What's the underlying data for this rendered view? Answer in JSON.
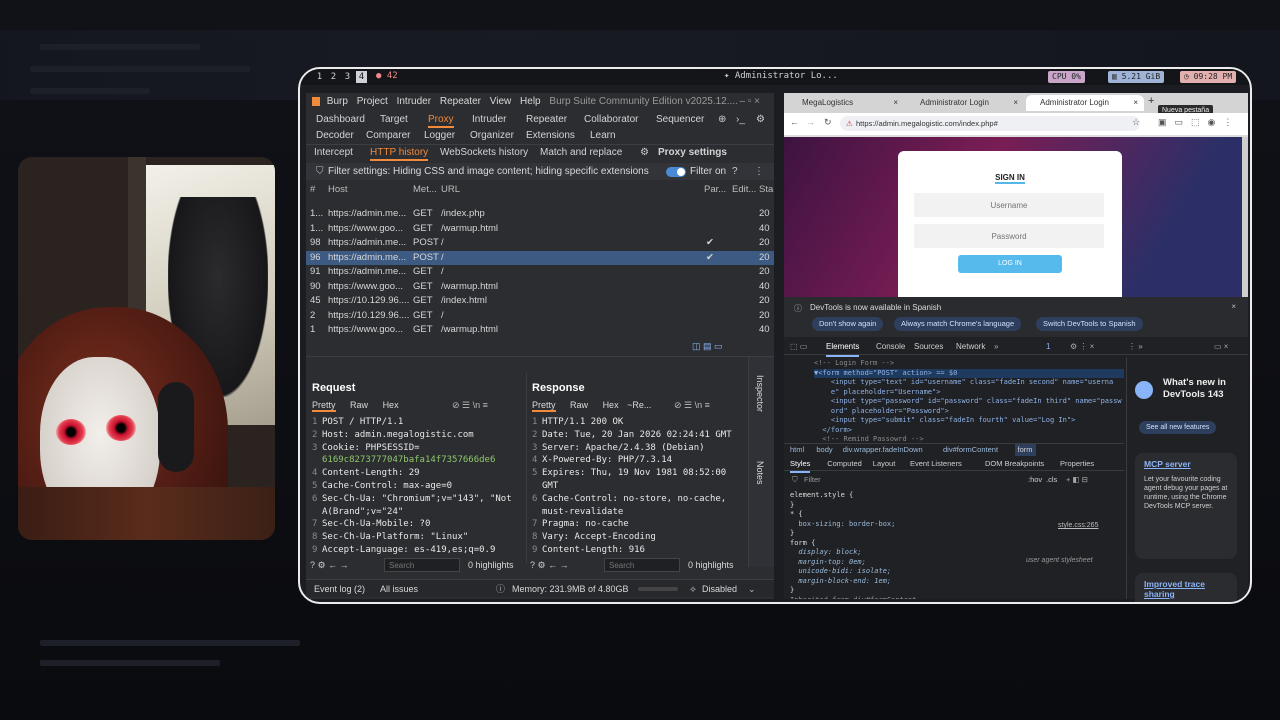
{
  "topbar": {
    "workspaces": [
      "1",
      "2",
      "3",
      "4"
    ],
    "badge": "● 42",
    "window_title": "✦ Administrator Lo...",
    "cpu": "CPU 0%",
    "mem": "▥ 5.21 GiB",
    "clock": "◷ 09:28 PM"
  },
  "burp": {
    "menu": [
      "Burp",
      "Project",
      "Intruder",
      "Repeater",
      "View",
      "Help"
    ],
    "title": "Burp Suite Community Edition v2025.12....",
    "tabs1": [
      "Dashboard",
      "Target",
      "Proxy",
      "Intruder",
      "Repeater",
      "Collaborator",
      "Sequencer"
    ],
    "tabs2": [
      "Decoder",
      "Comparer",
      "Logger",
      "Organizer",
      "Extensions",
      "Learn"
    ],
    "subtabs": [
      "Intercept",
      "HTTP history",
      "WebSockets history",
      "Match and replace"
    ],
    "proxy_settings": "Proxy settings",
    "filter_text": "Filter settings: Hiding CSS and image content; hiding specific extensions",
    "filter_on": "Filter on",
    "columns": [
      "#",
      "Host",
      "Met...",
      "URL",
      "Par...",
      "Edit...",
      "Sta"
    ],
    "rows": [
      {
        "n": "1...",
        "host": "https://admin.me...",
        "method": "GET",
        "url": "/index.php",
        "par": "",
        "status": "20"
      },
      {
        "n": "1...",
        "host": "https://www.goo...",
        "method": "GET",
        "url": "/warmup.html",
        "par": "",
        "status": "40"
      },
      {
        "n": "98",
        "host": "https://admin.me...",
        "method": "POST",
        "url": "/",
        "par": "✔",
        "status": "20"
      },
      {
        "n": "96",
        "host": "https://admin.me...",
        "method": "POST",
        "url": "/",
        "par": "✔",
        "status": "20"
      },
      {
        "n": "91",
        "host": "https://admin.me...",
        "method": "GET",
        "url": "/",
        "par": "",
        "status": "20"
      },
      {
        "n": "90",
        "host": "https://www.goo...",
        "method": "GET",
        "url": "/warmup.html",
        "par": "",
        "status": "40"
      },
      {
        "n": "45",
        "host": "https://10.129.96....",
        "method": "GET",
        "url": "/index.html",
        "par": "",
        "status": "20"
      },
      {
        "n": "2",
        "host": "https://10.129.96....",
        "method": "GET",
        "url": "/",
        "par": "",
        "status": "20"
      },
      {
        "n": "1",
        "host": "https://www.goo...",
        "method": "GET",
        "url": "/warmup.html",
        "par": "",
        "status": "40"
      }
    ],
    "request": {
      "title": "Request",
      "modes": [
        "Pretty",
        "Raw",
        "Hex"
      ],
      "lines": [
        [
          "1",
          "POST / HTTP/1.1"
        ],
        [
          "2",
          "Host: admin.megalogistic.com"
        ],
        [
          "3",
          "Cookie: PHPSESSID="
        ],
        [
          "",
          "6169c8273777047bafa14f7357666de6"
        ],
        [
          "4",
          "Content-Length: 29"
        ],
        [
          "5",
          "Cache-Control: max-age=0"
        ],
        [
          "6",
          "Sec-Ch-Ua: \"Chromium\";v=\"143\", \"Not"
        ],
        [
          "",
          "A(Brand\";v=\"24\""
        ],
        [
          "7",
          "Sec-Ch-Ua-Mobile: ?0"
        ],
        [
          "8",
          "Sec-Ch-Ua-Platform: \"Linux\""
        ],
        [
          "9",
          "Accept-Language: es-419,es;q=0.9"
        ]
      ]
    },
    "response": {
      "title": "Response",
      "modes": [
        "Pretty",
        "Raw",
        "Hex",
        "~Re..."
      ],
      "lines": [
        [
          "1",
          "HTTP/1.1 200 OK"
        ],
        [
          "2",
          "Date: Tue, 20 Jan 2026 02:24:41 GMT"
        ],
        [
          "3",
          "Server: Apache/2.4.38 (Debian)"
        ],
        [
          "4",
          "X-Powered-By: PHP/7.3.14"
        ],
        [
          "5",
          "Expires: Thu, 19 Nov 1981 08:52:00"
        ],
        [
          "",
          "GMT"
        ],
        [
          "6",
          "Cache-Control: no-store, no-cache,"
        ],
        [
          "",
          "must-revalidate"
        ],
        [
          "7",
          "Pragma: no-cache"
        ],
        [
          "8",
          "Vary: Accept-Encoding"
        ],
        [
          "9",
          "Content-Length: 916"
        ]
      ]
    },
    "search_placeholder": "Search",
    "highlights": "0 highlights",
    "side_tabs": [
      "Inspector",
      "Notes"
    ],
    "status": {
      "event_log": "Event log (2)",
      "all_issues": "All issues",
      "memory": "Memory: 231.9MB of 4.80GB",
      "disabled": "Disabled"
    }
  },
  "chrome": {
    "tabs": [
      "MegaLogistics",
      "Administrator Login",
      "Administrator Login"
    ],
    "tooltip": "Nueva pestaña",
    "url": "https://admin.megalogistic.com/index.php#",
    "login": {
      "title": "SIGN IN",
      "username": "Username",
      "password": "Password",
      "button": "LOG IN"
    },
    "devtools": {
      "notice": "DevTools is now available in Spanish",
      "btn1": "Don't show again",
      "btn2": "Always match Chrome's language",
      "btn3": "Switch DevTools to Spanish",
      "tabs": [
        "Elements",
        "Console",
        "Sources",
        "Network"
      ],
      "issues": "1",
      "code": [
        "<!-- Login Form -->",
        "▼<form method=\"POST\" action> == $0",
        "    <input type=\"text\" id=\"username\" class=\"fadeIn second\" name=\"userna",
        "    e\" placeholder=\"Username\">",
        "    <input type=\"password\" id=\"password\" class=\"fadeIn third\" name=\"passw",
        "    ord\" placeholder=\"Password\">",
        "    <input type=\"submit\" class=\"fadeIn fourth\" value=\"Log In\">",
        "  </form>",
        "  <!-- Remind Passowrd -->"
      ],
      "crumbs": [
        "html",
        "body",
        "div.wrapper.fadeInDown",
        "div#formContent",
        "form"
      ],
      "style_tabs": [
        "Styles",
        "Computed",
        "Layout",
        "Event Listeners",
        "DOM Breakpoints",
        "Properties"
      ],
      "filter": "Filter",
      "hov": ":hov",
      "cls": ".cls",
      "rules": [
        "element.style {",
        "}",
        "* {",
        "  box-sizing: border-box;",
        "}",
        "form {",
        "  display: block;",
        "  margin-top: 0em;",
        "  unicode-bidi: isolate;",
        "  margin-block-end: 1em;",
        "}",
        "Inherited from div#formContent"
      ],
      "source1": "style.css:265",
      "source2": "user agent stylesheet",
      "whatsnew": {
        "title": "What's new in DevTools 143",
        "see_all": "See all new features",
        "card1_title": "MCP server",
        "card1_body": "Let your favourite coding agent debug your pages at runtime, using the Chrome DevTools MCP server.",
        "card2_title": "Improved trace sharing"
      }
    }
  },
  "colors": {
    "accent": "#f08a3c",
    "selection": "#3d5a82",
    "chrome_blue": "#8ab4f8"
  }
}
